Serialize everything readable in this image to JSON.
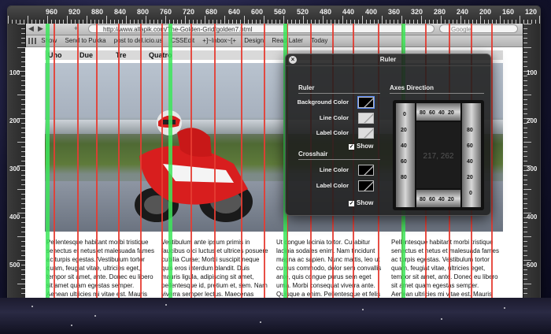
{
  "browser": {
    "url": "http://www.allapik.com/The-Golden-Grid/golden7.html",
    "search_placeholder": "Google",
    "bookmarks": [
      "Show",
      "Send to Pukka",
      "post to del.icio.us",
      "CSSEdit",
      "+]~Inbox~[+",
      "Design",
      "Read Later",
      "Today"
    ]
  },
  "rulers": {
    "top_labels": [
      "960",
      "920",
      "880",
      "840",
      "800",
      "760",
      "720",
      "680",
      "640",
      "600",
      "560",
      "520",
      "480",
      "440",
      "400",
      "360",
      "320",
      "280",
      "240",
      "200",
      "160",
      "120",
      "80",
      "40"
    ],
    "left_labels": [
      "100",
      "200",
      "300",
      "400",
      "500"
    ],
    "right_labels": [
      "100",
      "200",
      "300",
      "400",
      "500"
    ]
  },
  "page": {
    "columns": [
      "Uno",
      "Due",
      "Tre",
      "Quatro"
    ],
    "text": [
      "Pellentesque habitant morbi tristique senectus et netus et malesuada fames ac turpis egestas. Vestibulum tortor quam, feugiat vitae, ultricies eget, tempor sit amet, ante. Donec eu libero sit amet quam egestas semper. Aenean ultricies mi vitae est. Mauris",
      "Vestibulum ante ipsum primis in faucibus orci luctus et ultrices posuere cubilia Curae; Morbi suscipit neque quis eros interdum blandit. Duis mauris ligula, adipiscing sit amet, pellentesque id, pretium et, sem. Nam viverra semper lectus. Maecenas",
      "Ut congue lacinia tortor. Curabitur lacinia sodales enim. Nam tincidunt magna ac sapien. Nunc mattis, leo ut cursus commodo, dolor sem convallis ante, quis congue purus sem eget urna. Morbi consequat viverra ante. Quisque a enim. Pellentesque et felis",
      "Pellentesque habitant morbi tristique senectus et netus et malesuada fames ac turpis egestas. Vestibulum tortor quam, feugiat vitae, ultricies eget, tempor sit amet, ante. Donec eu libero sit amet quam egestas semper. Aenean ultricies mi vitae est. Mauris"
    ]
  },
  "dialog": {
    "title": "Ruler",
    "ruler_section": "Ruler",
    "background_color_label": "Background Color",
    "line_color_label": "Line Color",
    "label_color_label": "Label Color",
    "show_label": "Show",
    "crosshair_section": "Crosshair",
    "crosshair_line_color_label": "Line Color",
    "crosshair_label_color_label": "Label Color",
    "crosshair_show_label": "Show",
    "axes_section": "Axes Direction",
    "axes_top_numbers": [
      "80",
      "60",
      "40",
      "20"
    ],
    "axes_bottom_numbers": [
      "80",
      "60",
      "40",
      "20"
    ],
    "axes_left_numbers": [
      "0",
      "20",
      "40",
      "60",
      "80"
    ],
    "axes_right_numbers": [
      "80",
      "60",
      "40",
      "20",
      "0"
    ],
    "axes_readout": "217, 262",
    "show_checked": true,
    "crosshair_show_checked": true
  },
  "colors": {
    "guide_red": "#e63c32",
    "guide_green": "#3ce65a",
    "dialog_bg": "#1e1e1e"
  }
}
